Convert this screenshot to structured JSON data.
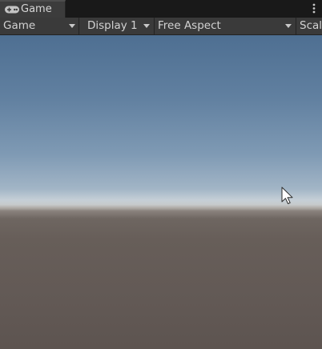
{
  "window": {
    "tab_label": "Game",
    "tab_icon": "gamepad-icon",
    "menu_icon": "kebab-menu-icon"
  },
  "toolbar": {
    "mode_label": "Game",
    "display_label": "Display 1",
    "aspect_label": "Free Aspect",
    "scale_label": "Scal"
  },
  "colors": {
    "sky_top": "#4e6f92",
    "horizon": "#c7cacb",
    "ground": "#625955",
    "toolbar_bg": "#3a3a3a",
    "tab_bg": "#3c3c3c"
  }
}
